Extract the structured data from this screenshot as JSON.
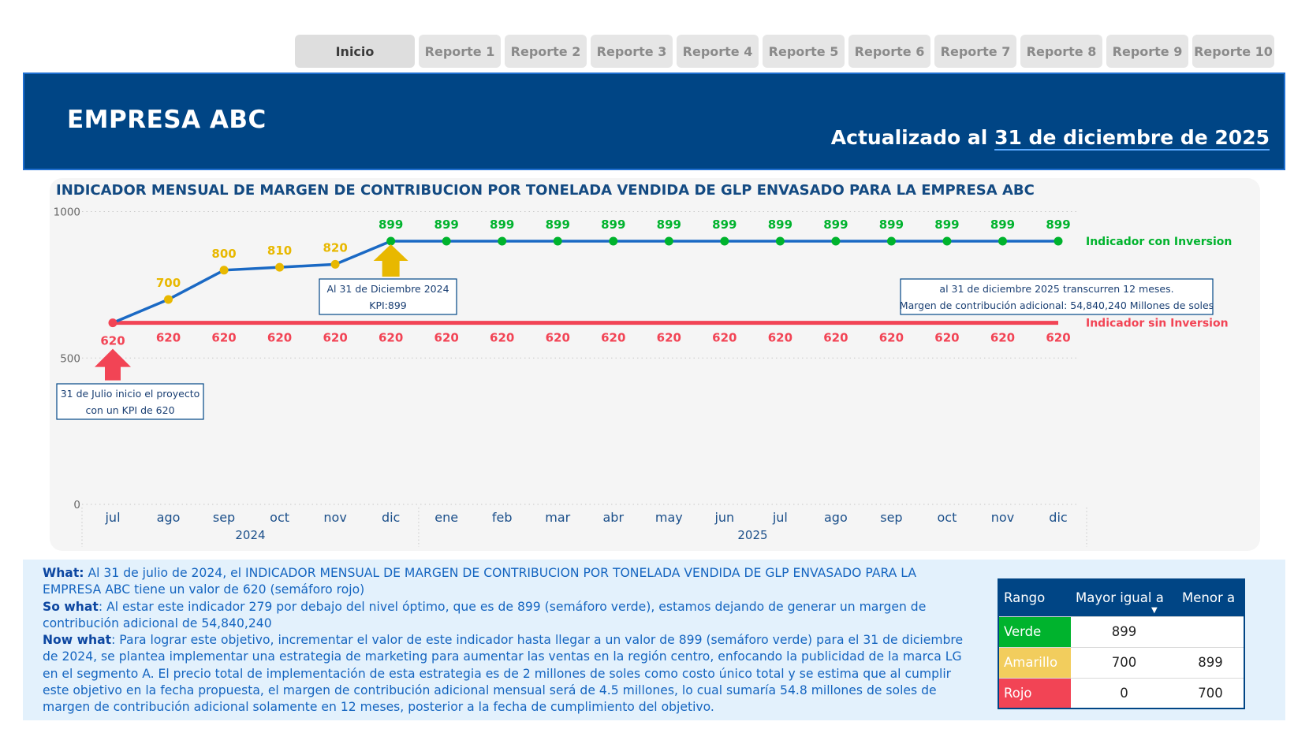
{
  "tabs": [
    "Inicio",
    "Reporte 1",
    "Reporte 2",
    "Reporte 3",
    "Reporte 4",
    "Reporte 5",
    "Reporte 6",
    "Reporte 7",
    "Reporte 8",
    "Reporte 9",
    "Reporte 10"
  ],
  "header": {
    "company": "EMPRESA ABC",
    "updated_prefix": "Actualizado al ",
    "updated_date": "31 de diciembre de 2025"
  },
  "colors": {
    "primary": "#004585",
    "green": "#00b32d",
    "yellow": "#e8b800",
    "red": "#f24455",
    "line_blue": "#1a69c4"
  },
  "chart_data": {
    "type": "line",
    "title": "INDICADOR MENSUAL DE MARGEN DE CONTRIBUCION POR TONELADA VENDIDA DE GLP ENVASADO PARA LA EMPRESA ABC",
    "categories": [
      "jul",
      "ago",
      "sep",
      "oct",
      "nov",
      "dic",
      "ene",
      "feb",
      "mar",
      "abr",
      "may",
      "jun",
      "jul",
      "ago",
      "sep",
      "oct",
      "nov",
      "dic"
    ],
    "year_groups": [
      {
        "label": "2024",
        "count": 6
      },
      {
        "label": "2025",
        "count": 12
      }
    ],
    "series": [
      {
        "name": "Indicador con Inversion",
        "values": [
          620,
          700,
          800,
          810,
          820,
          899,
          899,
          899,
          899,
          899,
          899,
          899,
          899,
          899,
          899,
          899,
          899,
          899
        ],
        "point_colors": [
          "red",
          "yellow",
          "yellow",
          "yellow",
          "yellow",
          "green",
          "green",
          "green",
          "green",
          "green",
          "green",
          "green",
          "green",
          "green",
          "green",
          "green",
          "green",
          "green"
        ]
      },
      {
        "name": "Indicador sin Inversion",
        "values": [
          620,
          620,
          620,
          620,
          620,
          620,
          620,
          620,
          620,
          620,
          620,
          620,
          620,
          620,
          620,
          620,
          620,
          620
        ]
      }
    ],
    "y_ticks": [
      "1000",
      "500",
      "0"
    ],
    "ylim": [
      0,
      1000
    ],
    "grid": true,
    "annotations": [
      {
        "lines": [
          "31 de Julio inicio el proyecto",
          "con un KPI de 620"
        ],
        "at_index": 0
      },
      {
        "lines": [
          "Al 31 de Diciembre 2024",
          "KPI:899"
        ],
        "at_index": 5
      },
      {
        "lines": [
          "al 31 de diciembre 2025 transcurren 12 meses.",
          "Margen de contribución adicional: 54,840,240 Millones de soles"
        ],
        "at_index": 17
      }
    ]
  },
  "analysis": [
    {
      "label": "What:",
      "text": " Al 31 de julio de 2024, el INDICADOR MENSUAL DE MARGEN DE CONTRIBUCION POR TONELADA VENDIDA DE GLP ENVASADO PARA LA EMPRESA ABC tiene un valor de 620 (semáforo rojo)"
    },
    {
      "label": "So what",
      "text": ": Al estar este indicador 279 por debajo del nivel óptimo, que es de 899 (semáforo verde), estamos dejando de generar un margen de contribución adicional de 54,840,240"
    },
    {
      "label": "Now what",
      "text": ": Para lograr este objetivo, incrementar el valor de este indicador hasta llegar a un valor de 899 (semáforo verde) para el 31 de diciembre de 2024, se plantea implementar una estrategia de marketing para aumentar las ventas en la región centro, enfocando la publicidad de la marca LG en el segmento A. El precio total de implementación de esta estrategia es de 2 millones de soles como costo único total y se estima que al cumplir este objetivo en la fecha propuesta, el margen de contribución adicional mensual será de 4.5 millones, lo cual sumaría 54.8 millones de soles de margen de contribución adicional solamente en 12 meses, posterior a la fecha de cumplimiento del objetivo."
    }
  ],
  "range_table": {
    "headers": [
      "Rango",
      "Mayor igual a",
      "Menor a"
    ],
    "rows": [
      {
        "name": "Verde",
        "color": "#00b32d",
        "min": "899",
        "max": ""
      },
      {
        "name": "Amarillo",
        "color": "#f2cd5d",
        "min": "700",
        "max": "899"
      },
      {
        "name": "Rojo",
        "color": "#f24455",
        "min": "0",
        "max": "700"
      }
    ]
  }
}
